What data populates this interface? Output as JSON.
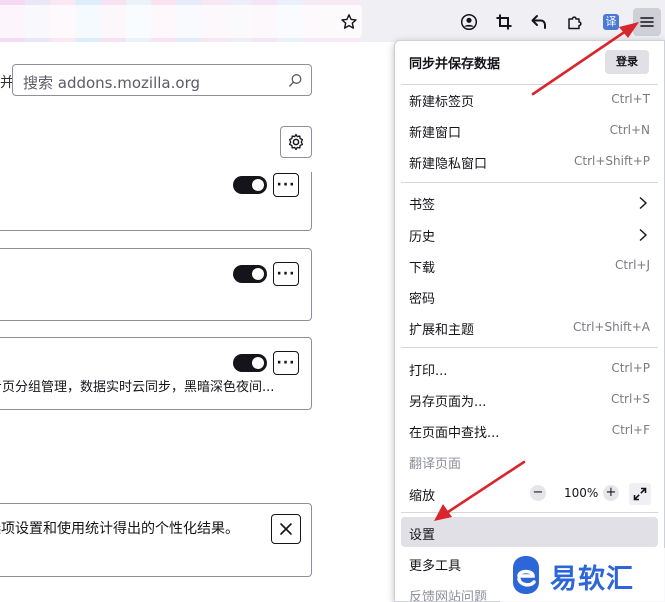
{
  "search": {
    "label_fragment": "并",
    "placeholder": "搜索 addons.mozilla.org"
  },
  "cards": [
    {
      "description": ""
    },
    {
      "description": ""
    },
    {
      "description": "专页分组管理，数据实时云同步，黑暗深色夜间..."
    }
  ],
  "notice": {
    "text": "选项设置和使用统计得出的个性化结果。"
  },
  "toolbar": {
    "translate_badge": "译"
  },
  "menu": {
    "sync_title": "同步并保存数据",
    "login": "登录",
    "new_tab": {
      "label": "新建标签页",
      "shortcut": "Ctrl+T"
    },
    "new_window": {
      "label": "新建窗口",
      "shortcut": "Ctrl+N"
    },
    "new_private": {
      "label": "新建隐私窗口",
      "shortcut": "Ctrl+Shift+P"
    },
    "bookmarks": {
      "label": "书签"
    },
    "history": {
      "label": "历史"
    },
    "downloads": {
      "label": "下载",
      "shortcut": "Ctrl+J"
    },
    "passwords": {
      "label": "密码"
    },
    "addons": {
      "label": "扩展和主题",
      "shortcut": "Ctrl+Shift+A"
    },
    "print": {
      "label": "打印...",
      "shortcut": "Ctrl+P"
    },
    "save_page": {
      "label": "另存页面为...",
      "shortcut": "Ctrl+S"
    },
    "find": {
      "label": "在页面中查找...",
      "shortcut": "Ctrl+F"
    },
    "translate": {
      "label": "翻译页面"
    },
    "zoom": {
      "label": "缩放",
      "minus": "−",
      "value": "100%",
      "plus": "+"
    },
    "settings": {
      "label": "设置"
    },
    "more_tools": {
      "label": "更多工具"
    },
    "report_site": {
      "label": "反馈网站问题"
    }
  },
  "watermark": {
    "text": "易软汇"
  },
  "colors": {
    "arrow": "#d9262d",
    "brand": "#2c66d8",
    "toggle_on": "#15141a"
  }
}
